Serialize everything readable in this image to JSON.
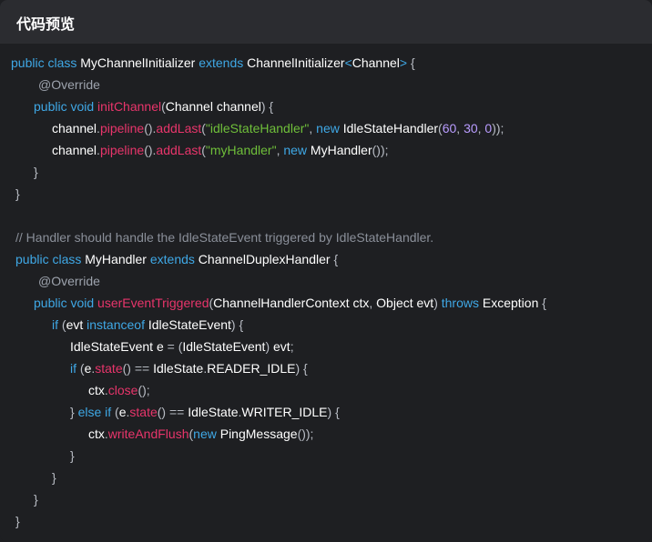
{
  "header": {
    "title": "代码预览"
  },
  "code": {
    "lines": [
      {
        "indent": 12,
        "tokens": [
          {
            "t": "kw",
            "v": "public class "
          },
          {
            "t": "tx",
            "v": "MyChannelInitializer "
          },
          {
            "t": "kw",
            "v": "extends "
          },
          {
            "t": "tx",
            "v": "ChannelInitializer"
          },
          {
            "t": "kw",
            "v": "<"
          },
          {
            "t": "tx",
            "v": "Channel"
          },
          {
            "t": "kw",
            "v": "> "
          },
          {
            "t": "pu",
            "v": "{"
          }
        ]
      },
      {
        "indent": 42,
        "tokens": [
          {
            "t": "ann",
            "v": "@Override"
          }
        ]
      },
      {
        "indent": 37,
        "tokens": [
          {
            "t": "kw",
            "v": "public void "
          },
          {
            "t": "fn",
            "v": "initChannel"
          },
          {
            "t": "pu",
            "v": "("
          },
          {
            "t": "tx",
            "v": "Channel channel"
          },
          {
            "t": "pu",
            "v": ") {"
          }
        ]
      },
      {
        "indent": 57,
        "tokens": [
          {
            "t": "tx",
            "v": "channel"
          },
          {
            "t": "pu",
            "v": "."
          },
          {
            "t": "fn",
            "v": "pipeline"
          },
          {
            "t": "pu",
            "v": "()."
          },
          {
            "t": "fn",
            "v": "addLast"
          },
          {
            "t": "pu",
            "v": "("
          },
          {
            "t": "str",
            "v": "\"idleStateHandler\""
          },
          {
            "t": "pu",
            "v": ", "
          },
          {
            "t": "kw",
            "v": "new "
          },
          {
            "t": "tx",
            "v": "IdleStateHandler"
          },
          {
            "t": "pu",
            "v": "("
          },
          {
            "t": "num",
            "v": "60"
          },
          {
            "t": "pu",
            "v": ", "
          },
          {
            "t": "num",
            "v": "30"
          },
          {
            "t": "pu",
            "v": ", "
          },
          {
            "t": "num",
            "v": "0"
          },
          {
            "t": "pu",
            "v": "));"
          }
        ]
      },
      {
        "indent": 57,
        "tokens": [
          {
            "t": "tx",
            "v": "channel"
          },
          {
            "t": "pu",
            "v": "."
          },
          {
            "t": "fn",
            "v": "pipeline"
          },
          {
            "t": "pu",
            "v": "()."
          },
          {
            "t": "fn",
            "v": "addLast"
          },
          {
            "t": "pu",
            "v": "("
          },
          {
            "t": "str",
            "v": "\"myHandler\""
          },
          {
            "t": "pu",
            "v": ", "
          },
          {
            "t": "kw",
            "v": "new "
          },
          {
            "t": "tx",
            "v": "MyHandler"
          },
          {
            "t": "pu",
            "v": "());"
          }
        ]
      },
      {
        "indent": 37,
        "tokens": [
          {
            "t": "pu",
            "v": "}"
          }
        ]
      },
      {
        "indent": 17,
        "tokens": [
          {
            "t": "pu",
            "v": "}"
          }
        ]
      },
      {
        "indent": 17,
        "tokens": []
      },
      {
        "indent": 17,
        "tokens": [
          {
            "t": "cm",
            "v": "// Handler should handle the IdleStateEvent triggered by IdleStateHandler."
          }
        ]
      },
      {
        "indent": 17,
        "tokens": [
          {
            "t": "kw",
            "v": "public class "
          },
          {
            "t": "tx",
            "v": "MyHandler "
          },
          {
            "t": "kw",
            "v": "extends "
          },
          {
            "t": "tx",
            "v": "ChannelDuplexHandler "
          },
          {
            "t": "pu",
            "v": "{"
          }
        ]
      },
      {
        "indent": 42,
        "tokens": [
          {
            "t": "ann",
            "v": "@Override"
          }
        ]
      },
      {
        "indent": 37,
        "tokens": [
          {
            "t": "kw",
            "v": "public void "
          },
          {
            "t": "fn",
            "v": "userEventTriggered"
          },
          {
            "t": "pu",
            "v": "("
          },
          {
            "t": "tx",
            "v": "ChannelHandlerContext ctx"
          },
          {
            "t": "pu",
            "v": ", "
          },
          {
            "t": "tx",
            "v": "Object evt"
          },
          {
            "t": "pu",
            "v": ") "
          },
          {
            "t": "kw",
            "v": "throws "
          },
          {
            "t": "tx",
            "v": "Exception "
          },
          {
            "t": "pu",
            "v": "{"
          }
        ]
      },
      {
        "indent": 57,
        "tokens": [
          {
            "t": "kw",
            "v": "if "
          },
          {
            "t": "pu",
            "v": "("
          },
          {
            "t": "tx",
            "v": "evt "
          },
          {
            "t": "kw",
            "v": "instanceof "
          },
          {
            "t": "tx",
            "v": "IdleStateEvent"
          },
          {
            "t": "pu",
            "v": ") {"
          }
        ]
      },
      {
        "indent": 77,
        "tokens": [
          {
            "t": "tx",
            "v": "IdleStateEvent e "
          },
          {
            "t": "pu",
            "v": "= ("
          },
          {
            "t": "tx",
            "v": "IdleStateEvent"
          },
          {
            "t": "pu",
            "v": ") "
          },
          {
            "t": "tx",
            "v": "evt"
          },
          {
            "t": "pu",
            "v": ";"
          }
        ]
      },
      {
        "indent": 77,
        "tokens": [
          {
            "t": "kw",
            "v": "if "
          },
          {
            "t": "pu",
            "v": "("
          },
          {
            "t": "tx",
            "v": "e"
          },
          {
            "t": "pu",
            "v": "."
          },
          {
            "t": "fn",
            "v": "state"
          },
          {
            "t": "pu",
            "v": "() == "
          },
          {
            "t": "tx",
            "v": "IdleState"
          },
          {
            "t": "pu",
            "v": "."
          },
          {
            "t": "tx",
            "v": "READER_IDLE"
          },
          {
            "t": "pu",
            "v": ") {"
          }
        ]
      },
      {
        "indent": 97,
        "tokens": [
          {
            "t": "tx",
            "v": "ctx"
          },
          {
            "t": "pu",
            "v": "."
          },
          {
            "t": "fn",
            "v": "close"
          },
          {
            "t": "pu",
            "v": "();"
          }
        ]
      },
      {
        "indent": 77,
        "tokens": [
          {
            "t": "pu",
            "v": "} "
          },
          {
            "t": "kw",
            "v": "else if "
          },
          {
            "t": "pu",
            "v": "("
          },
          {
            "t": "tx",
            "v": "e"
          },
          {
            "t": "pu",
            "v": "."
          },
          {
            "t": "fn",
            "v": "state"
          },
          {
            "t": "pu",
            "v": "() == "
          },
          {
            "t": "tx",
            "v": "IdleState"
          },
          {
            "t": "pu",
            "v": "."
          },
          {
            "t": "tx",
            "v": "WRITER_IDLE"
          },
          {
            "t": "pu",
            "v": ") {"
          }
        ]
      },
      {
        "indent": 97,
        "tokens": [
          {
            "t": "tx",
            "v": "ctx"
          },
          {
            "t": "pu",
            "v": "."
          },
          {
            "t": "fn",
            "v": "writeAndFlush"
          },
          {
            "t": "pu",
            "v": "("
          },
          {
            "t": "kw",
            "v": "new "
          },
          {
            "t": "tx",
            "v": "PingMessage"
          },
          {
            "t": "pu",
            "v": "());"
          }
        ]
      },
      {
        "indent": 77,
        "tokens": [
          {
            "t": "pu",
            "v": "}"
          }
        ]
      },
      {
        "indent": 57,
        "tokens": [
          {
            "t": "pu",
            "v": "}"
          }
        ]
      },
      {
        "indent": 37,
        "tokens": [
          {
            "t": "pu",
            "v": "}"
          }
        ]
      },
      {
        "indent": 17,
        "tokens": [
          {
            "t": "pu",
            "v": "}"
          }
        ]
      }
    ]
  }
}
